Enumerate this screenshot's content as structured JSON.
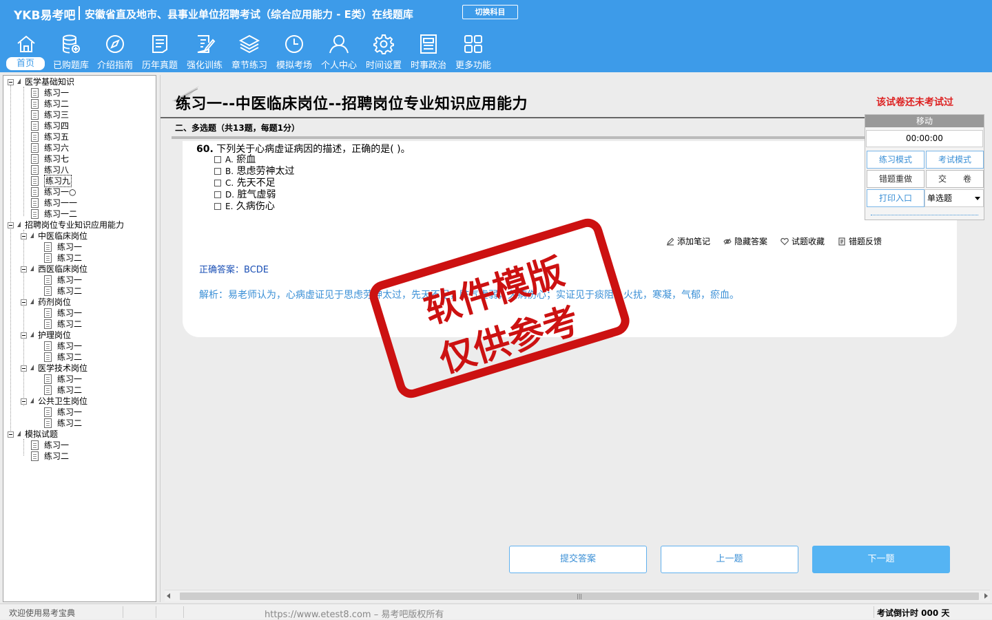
{
  "header": {
    "brand": "YKB易考吧",
    "title": "安徽省直及地市、县事业单位招聘考试（综合应用能力 - E类）在线题库",
    "switch_label": "切换科目",
    "nav": [
      {
        "label": "首页",
        "icon": "home-icon"
      },
      {
        "label": "已购题库",
        "icon": "database-icon"
      },
      {
        "label": "介绍指南",
        "icon": "compass-icon"
      },
      {
        "label": "历年真题",
        "icon": "list-doc-icon"
      },
      {
        "label": "强化训练",
        "icon": "edit-doc-icon"
      },
      {
        "label": "章节练习",
        "icon": "layers-icon"
      },
      {
        "label": "模拟考场",
        "icon": "clock-icon"
      },
      {
        "label": "个人中心",
        "icon": "user-icon"
      },
      {
        "label": "时间设置",
        "icon": "gear-icon"
      },
      {
        "label": "时事政治",
        "icon": "newspaper-icon"
      },
      {
        "label": "更多功能",
        "icon": "grid-icon"
      }
    ]
  },
  "tree": {
    "nodes": [
      "医学基础知识",
      "练习一",
      "练习二",
      "练习三",
      "练习四",
      "练习五",
      "练习六",
      "练习七",
      "练习八",
      "练习九",
      "练习一○",
      "练习一一",
      "练习一二",
      "招聘岗位专业知识应用能力",
      "中医临床岗位",
      "练习一",
      "练习二",
      "西医临床岗位",
      "练习一",
      "练习二",
      "药剂岗位",
      "练习一",
      "练习二",
      "护理岗位",
      "练习一",
      "练习二",
      "医学技术岗位",
      "练习一",
      "练习二",
      "公共卫生岗位",
      "练习一",
      "练习二",
      "模拟试题",
      "练习一",
      "练习二"
    ]
  },
  "main": {
    "title": "练习一--中医临床岗位--招聘岗位专业知识应用能力",
    "status": "该试卷还未考试过",
    "section": "二、多选题（共13题，每题1分）",
    "question": {
      "number": "60.",
      "stem": "下列关于心病虚证病因的描述，正确的是(  )。",
      "options": [
        {
          "letter": "A.",
          "text": "瘀血"
        },
        {
          "letter": "B.",
          "text": "思虑劳神太过"
        },
        {
          "letter": "C.",
          "text": "先天不足"
        },
        {
          "letter": "D.",
          "text": "脏气虚弱"
        },
        {
          "letter": "E.",
          "text": "久病伤心"
        }
      ]
    },
    "tools": {
      "note": "添加笔记",
      "hide": "隐藏答案",
      "fav": "试题收藏",
      "feedback": "错题反馈"
    },
    "answer": "正确答案：BCDE",
    "analysis": "解析：易老师认为，心病虚证见于思虑劳神太过，先天不足，脏气虚弱，久病伤心；实证见于痰阻，火扰，寒凝，气郁，瘀血。",
    "stamp": {
      "line1": "软件模版",
      "line2": "仅供参考"
    }
  },
  "control": {
    "move": "移动",
    "timer": "00:00:00",
    "practice_mode": "练习模式",
    "exam_mode": "考试模式",
    "redo": "错题重做",
    "submit_paper": "交　　卷",
    "print": "打印入口",
    "type_select": "单选题"
  },
  "buttons": {
    "submit": "提交答案",
    "prev": "上一题",
    "next": "下一题"
  },
  "status": {
    "welcome": "欢迎使用易考宝典",
    "url": "https://www.etest8.com – 易考吧版权所有",
    "countdown": "考试倒计时 000 天"
  },
  "colors": {
    "header_bg": "#3d9be9",
    "accent": "#3a8fd6",
    "alert": "#d22222",
    "stamp": "#cc1111"
  }
}
